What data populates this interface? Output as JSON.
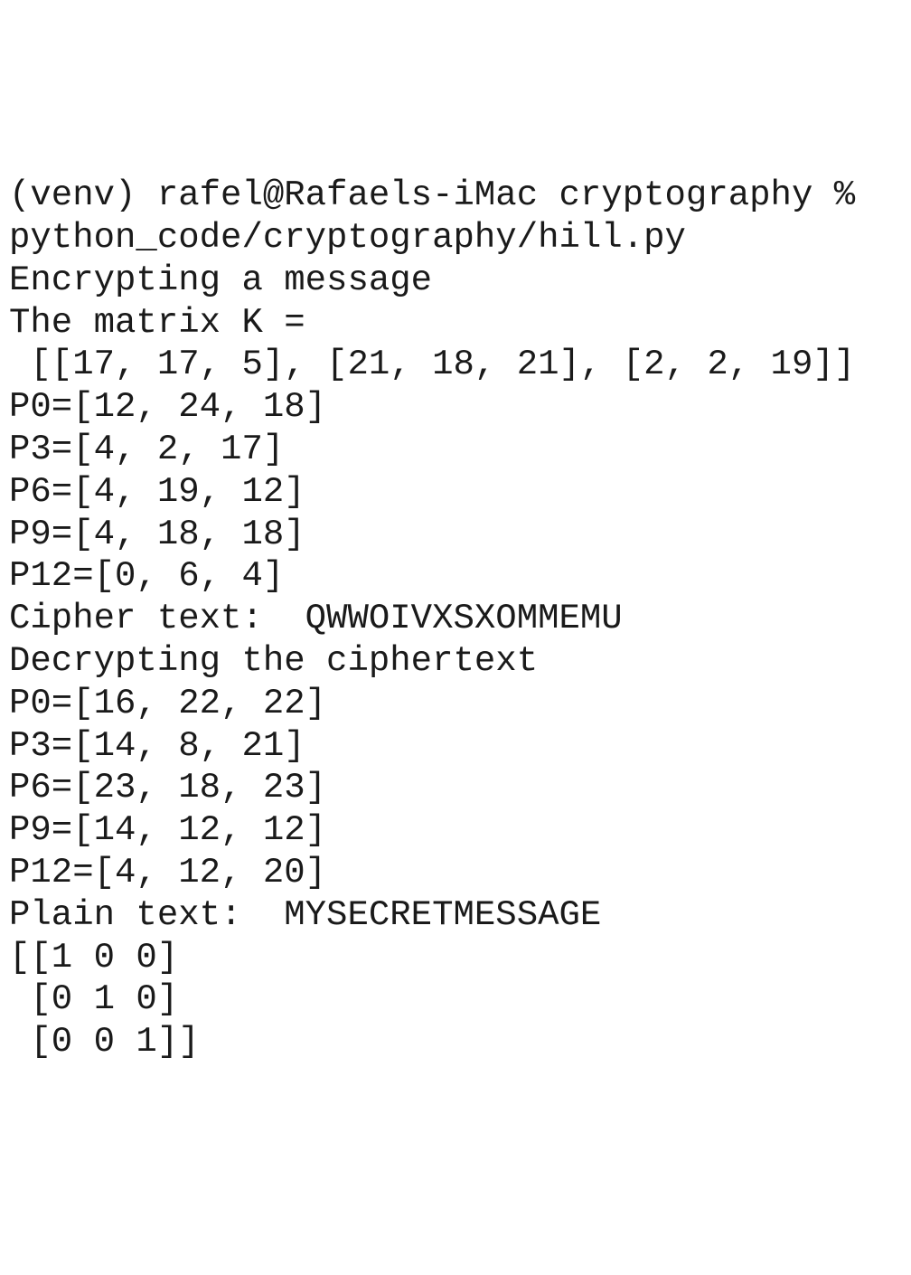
{
  "terminal": {
    "lines": [
      "(venv) rafel@Rafaels-iMac cryptography % ",
      "python_code/cryptography/hill.py",
      "Encrypting a message",
      "The matrix K =",
      " [[17, 17, 5], [21, 18, 21], [2, 2, 19]]",
      "P0=[12, 24, 18]",
      "P3=[4, 2, 17]",
      "P6=[4, 19, 12]",
      "P9=[4, 18, 18]",
      "P12=[0, 6, 4]",
      "Cipher text:  QWWOIVXSXOMMEMU",
      "Decrypting the ciphertext",
      "P0=[16, 22, 22]",
      "P3=[14, 8, 21]",
      "P6=[23, 18, 23]",
      "P9=[14, 12, 12]",
      "P12=[4, 12, 20]",
      "Plain text:  MYSECRETMESSAGE",
      "[[1 0 0]",
      " [0 1 0]",
      " [0 0 1]]"
    ]
  }
}
